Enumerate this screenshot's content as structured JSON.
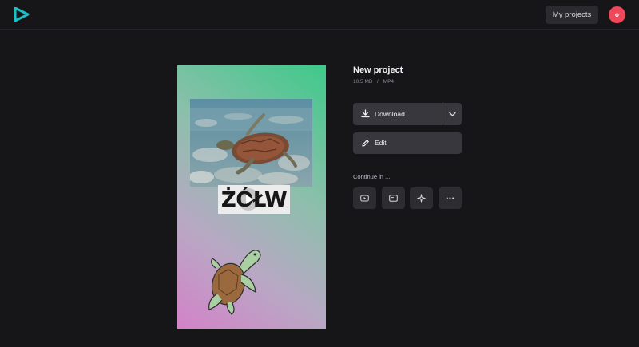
{
  "header": {
    "logo_icon": "play-logo-icon",
    "my_projects_label": "My projects",
    "avatar_initial": "o",
    "avatar_color": "#f0485b",
    "brand_color": "#17c3c9"
  },
  "preview": {
    "caption": "ŻÓŁW",
    "play_icon": "play-icon"
  },
  "project": {
    "title": "New project",
    "size": "10.5 MB",
    "separator": "/",
    "format": "MP4"
  },
  "actions": {
    "download_label": "Download",
    "download_icon": "download-icon",
    "download_menu_icon": "chevron-down-icon",
    "edit_label": "Edit",
    "edit_icon": "pencil-icon",
    "continue_label": "Continue in ...",
    "continue_options": [
      {
        "icon": "youtube-icon"
      },
      {
        "icon": "subtitles-icon"
      },
      {
        "icon": "sparkle-icon"
      },
      {
        "icon": "more-icon"
      }
    ]
  }
}
